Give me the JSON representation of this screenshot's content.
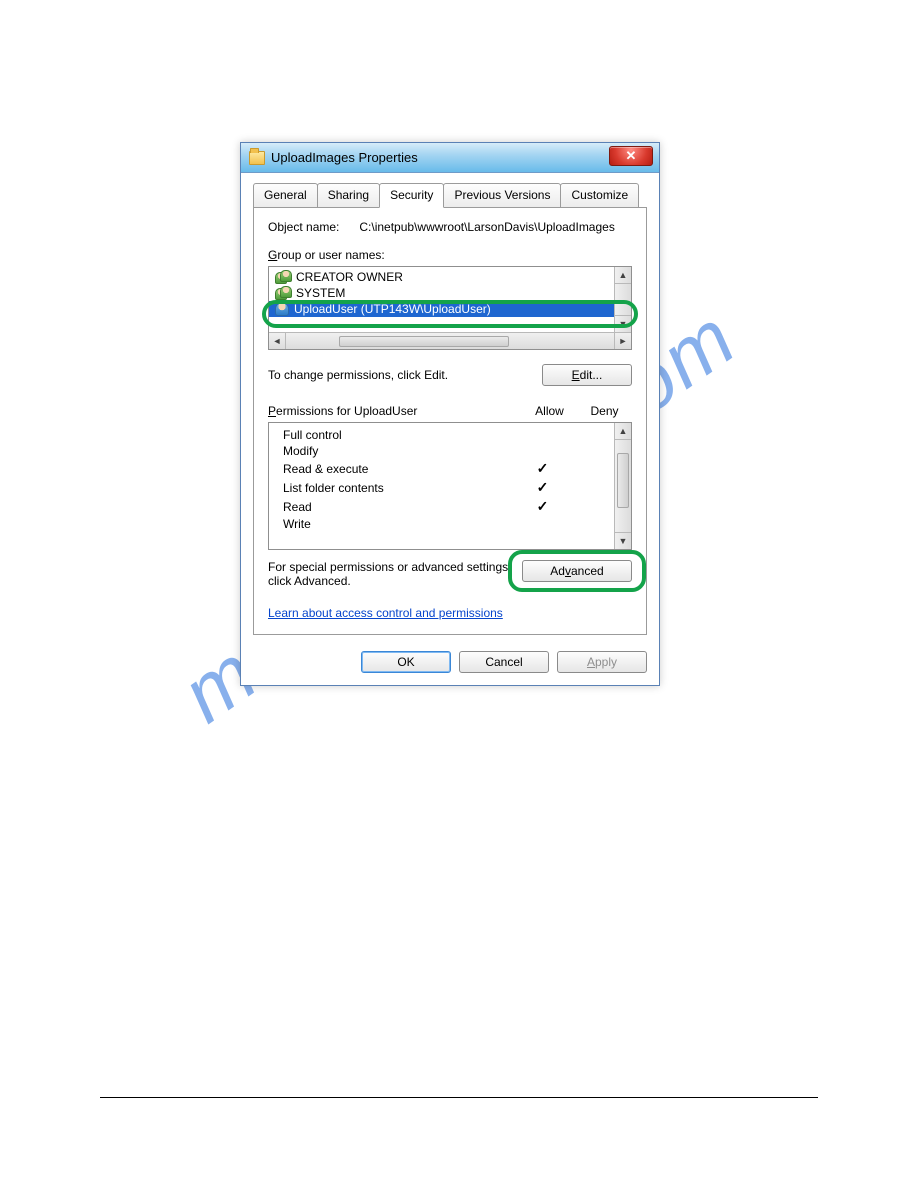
{
  "watermark": "manualshive.com",
  "window": {
    "title": "UploadImages Properties"
  },
  "tabs": {
    "general": "General",
    "sharing": "Sharing",
    "security": "Security",
    "previous": "Previous Versions",
    "customize": "Customize"
  },
  "security": {
    "object_name_label": "Object name:",
    "object_name_value": "C:\\inetpub\\wwwroot\\LarsonDavis\\UploadImages",
    "group_label": "Group or user names:",
    "users": [
      {
        "type": "group",
        "name": "CREATOR OWNER"
      },
      {
        "type": "group",
        "name": "SYSTEM"
      },
      {
        "type": "user",
        "name": "UploadUser (UTP143W\\UploadUser)",
        "selected": true
      }
    ],
    "change_text": "To change permissions, click Edit.",
    "edit_button": "Edit...",
    "perm_header_name": "Permissions for UploadUser",
    "perm_header_allow": "Allow",
    "perm_header_deny": "Deny",
    "permissions": [
      {
        "name": "Full control",
        "allow": false,
        "deny": false
      },
      {
        "name": "Modify",
        "allow": false,
        "deny": false
      },
      {
        "name": "Read & execute",
        "allow": true,
        "deny": false
      },
      {
        "name": "List folder contents",
        "allow": true,
        "deny": false
      },
      {
        "name": "Read",
        "allow": true,
        "deny": false
      },
      {
        "name": "Write",
        "allow": false,
        "deny": false
      }
    ],
    "advanced_text": "For special permissions or advanced settings, click Advanced.",
    "advanced_button": "Advanced",
    "learn_link": "Learn about access control and permissions"
  },
  "buttons": {
    "ok": "OK",
    "cancel": "Cancel",
    "apply": "Apply"
  }
}
